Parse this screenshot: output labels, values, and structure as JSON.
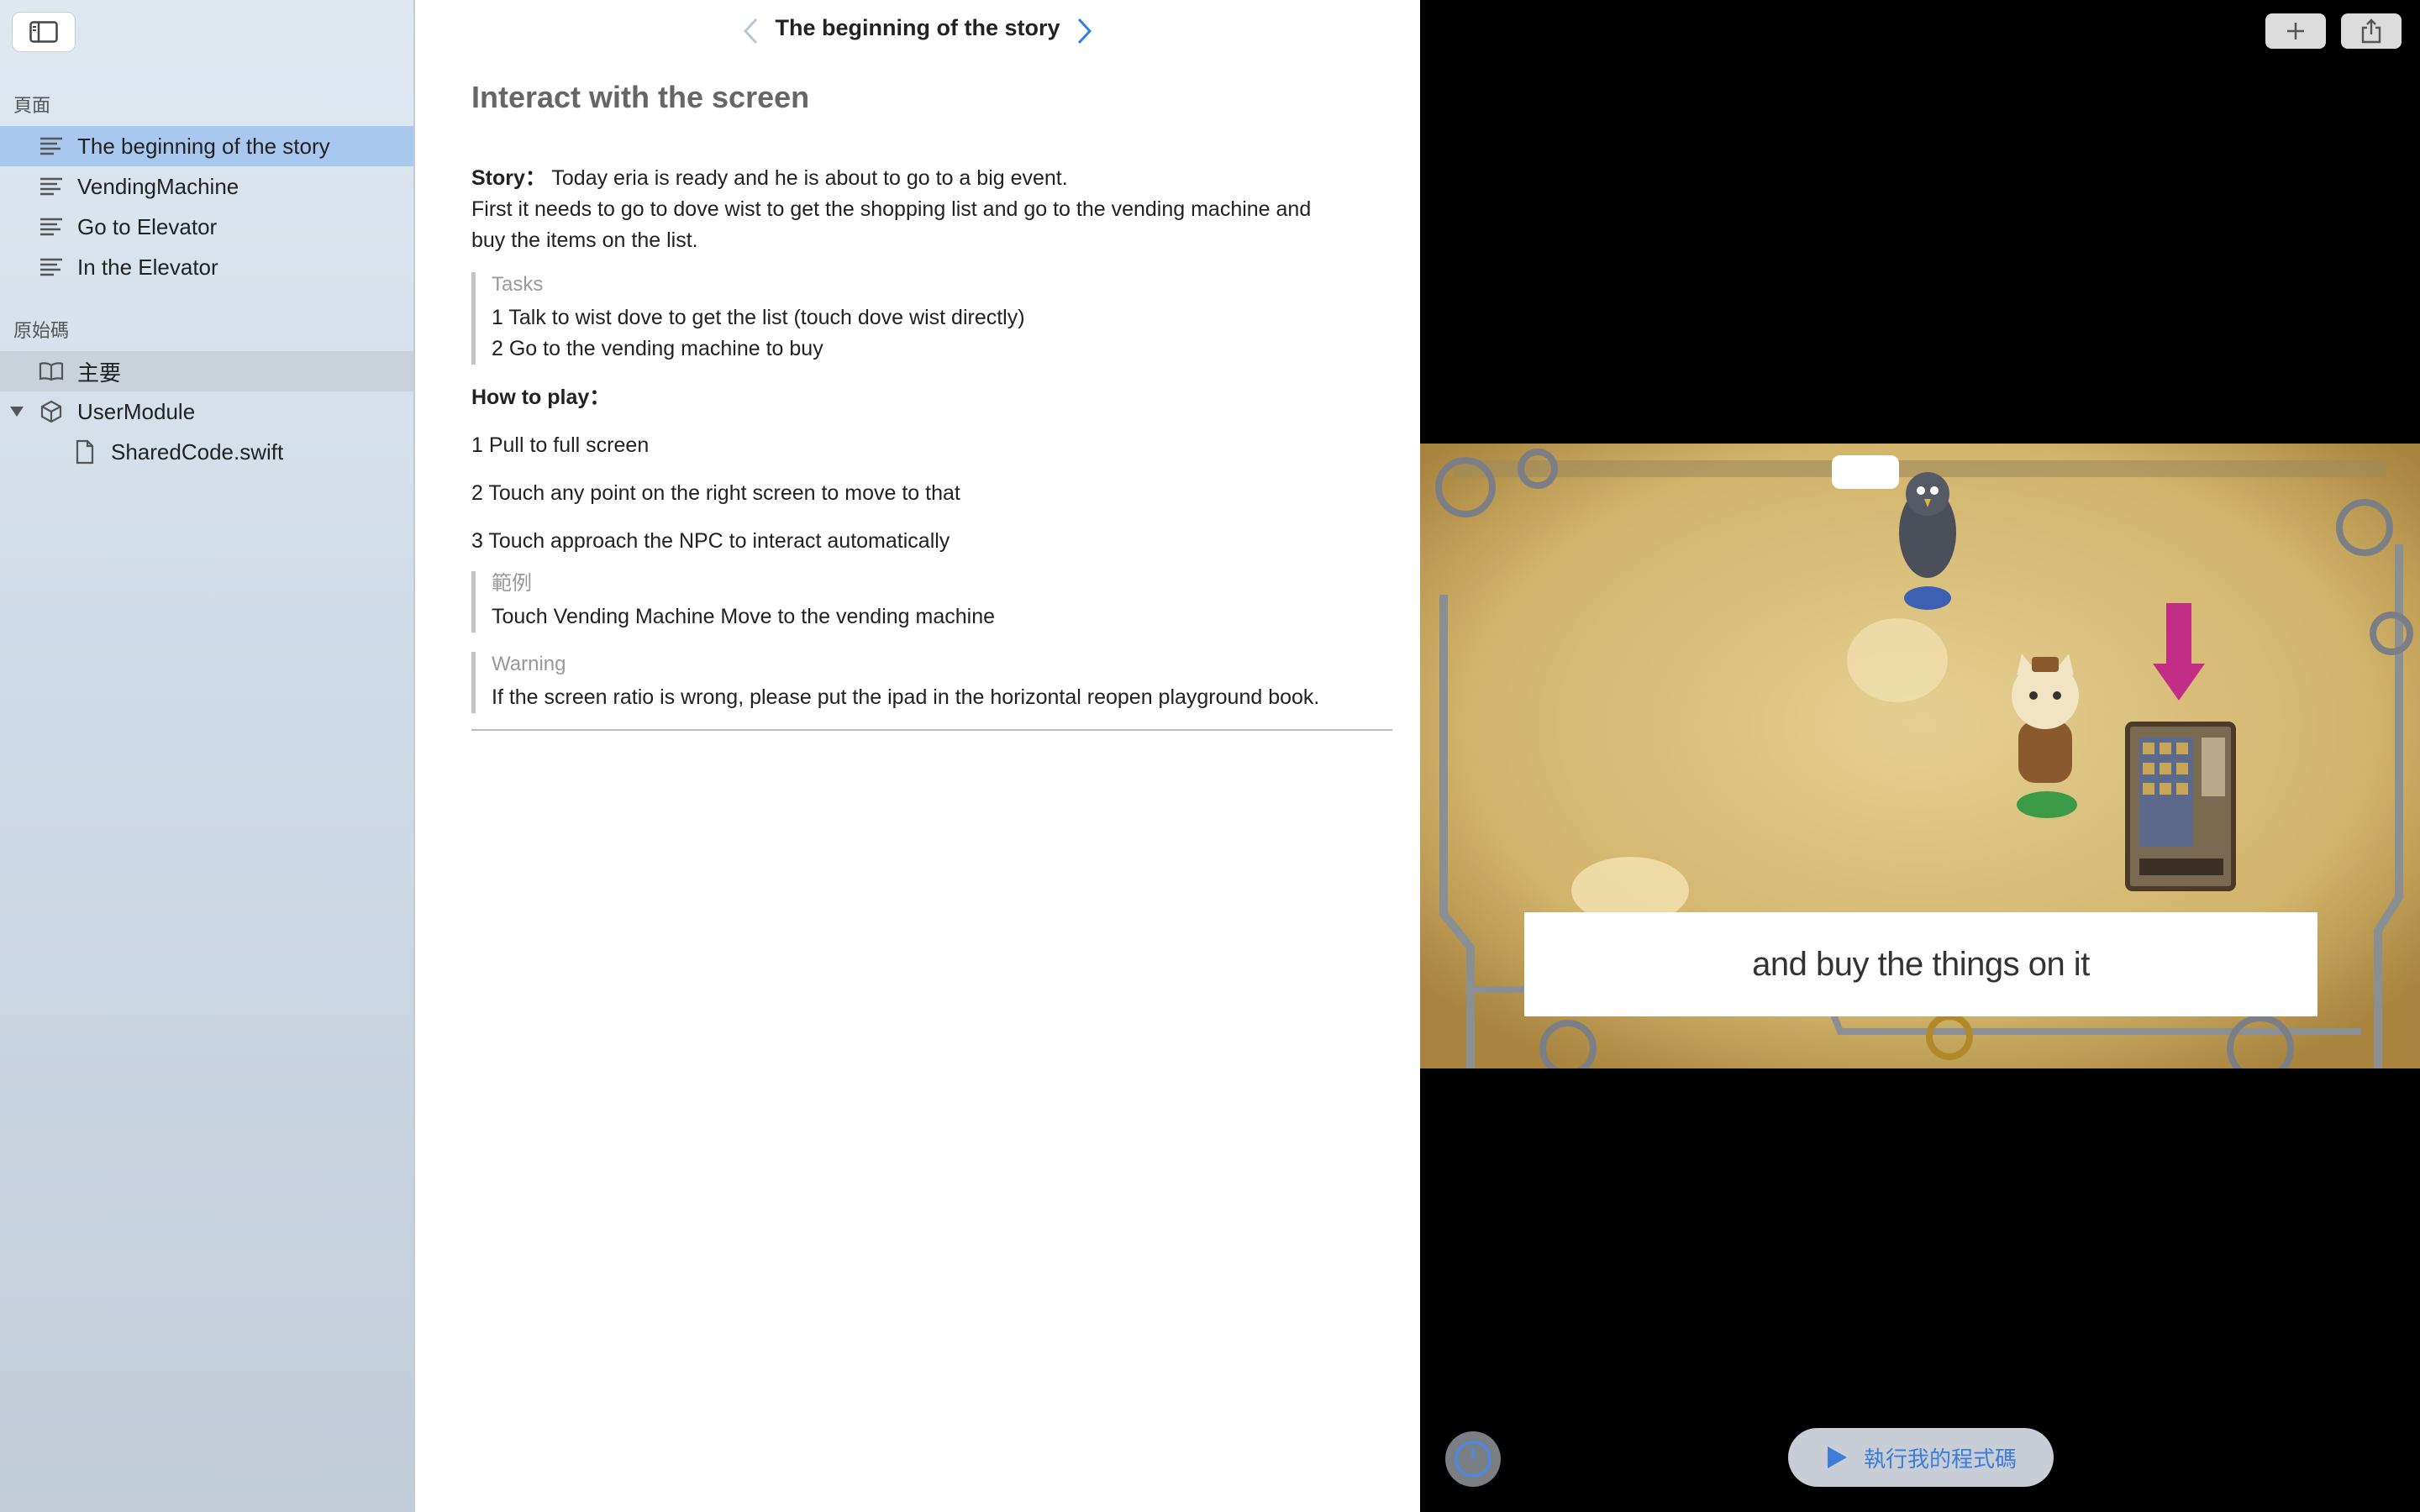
{
  "sidebar": {
    "toggle_icon": "sidebar-toggle-icon",
    "pages_header": "頁面",
    "pages": [
      {
        "label": "The beginning of the story",
        "icon": "page-lines-icon",
        "selected": true
      },
      {
        "label": "VendingMachine",
        "icon": "page-lines-icon"
      },
      {
        "label": "Go to Elevator",
        "icon": "page-lines-icon"
      },
      {
        "label": "In the Elevator",
        "icon": "page-lines-icon"
      }
    ],
    "source_header": "原始碼",
    "source": [
      {
        "label": "主要",
        "icon": "book-icon"
      },
      {
        "label": "UserModule",
        "icon": "package-icon"
      },
      {
        "label": "SharedCode.swift",
        "icon": "file-icon"
      }
    ]
  },
  "doc": {
    "nav_title": "The beginning of the story",
    "heading": "Interact with the screen",
    "story_label": "Story：",
    "story_text": " Today eria is ready and he is about to go to a big event.",
    "story_line2": "First it needs to go to dove wist to get the shopping list and go to the vending machine and",
    "story_line3": "buy the items on the list.",
    "tasks": {
      "title": "Tasks",
      "items": [
        "1 Talk to wist dove to get the list (touch dove wist directly)",
        "2 Go to the vending machine to buy"
      ]
    },
    "how_to_play": "How to play：",
    "steps": [
      "1 Pull to full screen",
      "2 Touch any point on the right screen to move to that",
      "3 Touch approach the NPC to interact automatically"
    ],
    "example": {
      "title": "範例",
      "text": "Touch Vending Machine Move to the vending machine"
    },
    "warning": {
      "title": "Warning",
      "text": "If the screen ratio is wrong, please put the ipad in the horizontal reopen playground book."
    }
  },
  "live": {
    "add_icon": "plus-icon",
    "share_icon": "share-icon",
    "caption": "and buy the things on it",
    "meter_icon": "speed-meter-icon",
    "run_label": "執行我的程式碼",
    "run_icon": "play-icon"
  }
}
